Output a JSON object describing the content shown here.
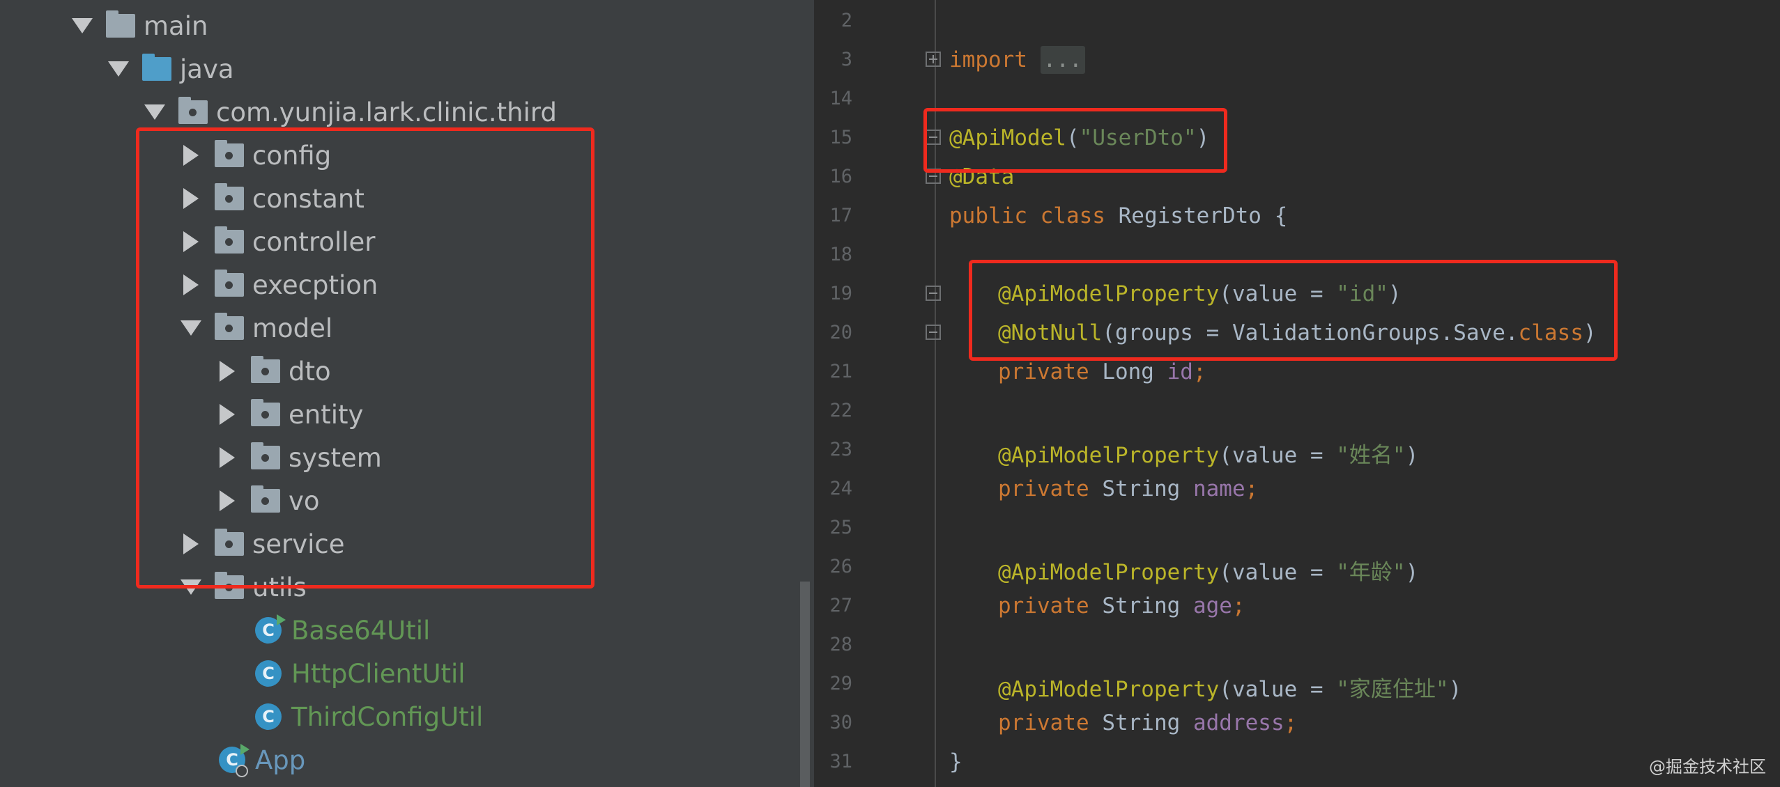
{
  "tree": {
    "main": "main",
    "java": "java",
    "package": "com.yunjia.lark.clinic.third",
    "config": "config",
    "constant": "constant",
    "controller": "controller",
    "execption": "execption",
    "model": "model",
    "dto": "dto",
    "entity": "entity",
    "system": "system",
    "vo": "vo",
    "service": "service",
    "utils": "utils",
    "base64util": "Base64Util",
    "httpclientutil": "HttpClientUtil",
    "thirdconfigutil": "ThirdConfigUtil",
    "app": "App",
    "class_icon_letter": "C"
  },
  "editor": {
    "line_numbers": [
      "2",
      "3",
      "14",
      "15",
      "16",
      "17",
      "18",
      "19",
      "20",
      "21",
      "22",
      "23",
      "24",
      "25",
      "26",
      "27",
      "28",
      "29",
      "30",
      "31"
    ],
    "code": {
      "import_kw": "import",
      "import_folded": "...",
      "apimodel": "@ApiModel",
      "apimodel_open": "(",
      "apimodel_value": "\"UserDto\"",
      "apimodel_close": ")",
      "data": "@Data",
      "class_kw": "public class",
      "class_name": " RegisterDto {",
      "p1_anno": "@ApiModelProperty",
      "p1_pre": "(value = ",
      "p1_val": "\"id\"",
      "p1_post": ")",
      "notnull_anno": "@NotNull",
      "notnull_pre": "(groups = ValidationGroups.Save.",
      "notnull_kw": "class",
      "notnull_post": ")",
      "f1_kw": "private",
      "f1_type": " Long ",
      "f1_name": "id",
      "f1_semi": ";",
      "p2_anno": "@ApiModelProperty",
      "p2_pre": "(value = ",
      "p2_val": "\"姓名\"",
      "p2_post": ")",
      "f2_kw": "private",
      "f2_type": " String ",
      "f2_name": "name",
      "f2_semi": ";",
      "p3_anno": "@ApiModelProperty",
      "p3_pre": "(value = ",
      "p3_val": "\"年龄\"",
      "p3_post": ")",
      "f3_kw": "private",
      "f3_type": " String ",
      "f3_name": "age",
      "f3_semi": ";",
      "p4_anno": "@ApiModelProperty",
      "p4_pre": "(value = ",
      "p4_val": "\"家庭住址\"",
      "p4_post": ")",
      "f4_kw": "private",
      "f4_type": " String ",
      "f4_name": "address",
      "f4_semi": ";",
      "close": "}"
    },
    "watermark": "@掘金技术社区"
  },
  "colors": {
    "highlight_box": "#ef2a1e",
    "annotation": "#bbb529",
    "keyword": "#cc7832",
    "string": "#6a8759",
    "field": "#9876aa",
    "class_name_green": "#629755"
  }
}
